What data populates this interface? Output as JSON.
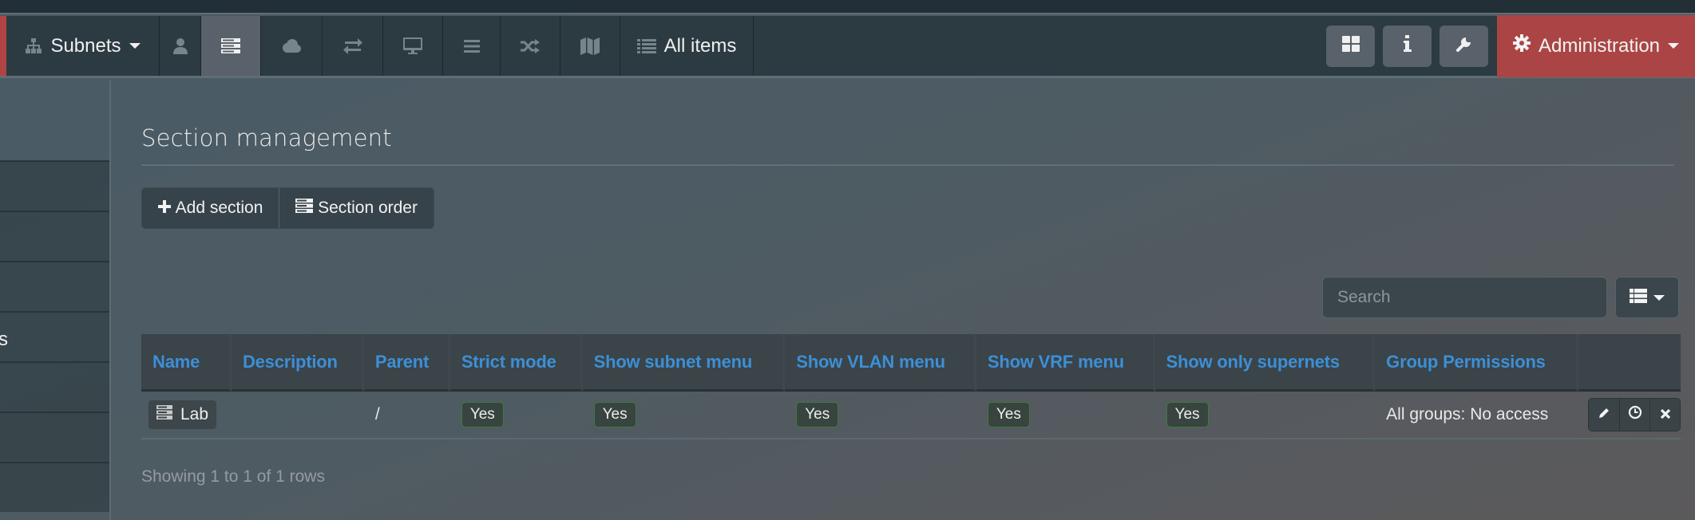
{
  "navbar": {
    "subnets_label": "Subnets",
    "all_items_label": "All items",
    "admin_label": "Administration",
    "icons": [
      "sitemap-icon",
      "user-icon",
      "server-icon",
      "cloud-icon",
      "exchange-icon",
      "desktop-icon",
      "bars-icon",
      "random-icon",
      "map-icon",
      "list-icon"
    ],
    "right_buttons": [
      "dashboard-icon",
      "info-icon",
      "wrench-icon"
    ]
  },
  "sidebar": {
    "visible_fragment": "s"
  },
  "page": {
    "title": "Section management",
    "add_section_label": "Add section",
    "section_order_label": "Section order",
    "search_placeholder": "Search"
  },
  "table": {
    "columns": [
      "Name",
      "Description",
      "Parent",
      "Strict mode",
      "Show subnet menu",
      "Show VLAN menu",
      "Show VRF menu",
      "Show only supernets",
      "Group Permissions",
      ""
    ],
    "rows": [
      {
        "name": "Lab",
        "description": "",
        "parent": "/",
        "strict_mode": "Yes",
        "show_subnet_menu": "Yes",
        "show_vlan_menu": "Yes",
        "show_vrf_menu": "Yes",
        "show_only_supernets": "Yes",
        "group_permissions": "All groups: No access"
      }
    ],
    "footer": "Showing 1 to 1 of 1 rows"
  },
  "colors": {
    "accent_red": "#ab4545",
    "header_link_blue": "#3d8fd6",
    "badge_border_green": "#3e7a3c"
  }
}
